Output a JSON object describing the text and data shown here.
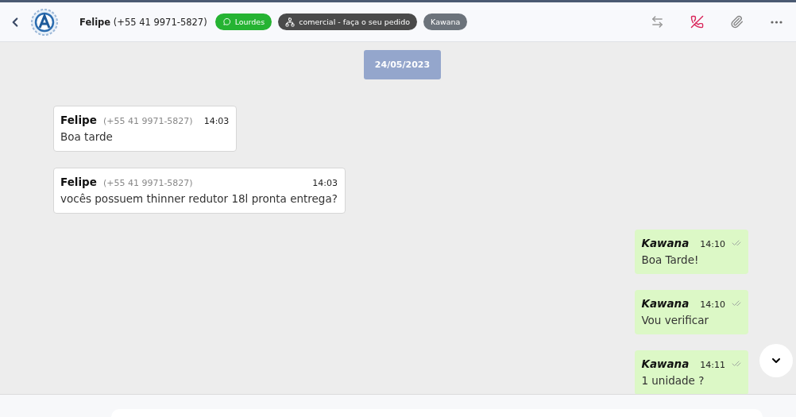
{
  "header": {
    "contact_name": "Felipe",
    "contact_phone": "(+55 41 9971-5827)",
    "tags": [
      {
        "kind": "whatsapp",
        "label": "Lourdes",
        "color": "#25b332"
      },
      {
        "kind": "queue",
        "label": "comercial - faça o seu pedido",
        "color": "#4a4a4a"
      },
      {
        "kind": "user",
        "label": "Kawana",
        "color": "#6c737b"
      }
    ]
  },
  "date_divider": "24/05/2023",
  "messages": [
    {
      "kind": "incoming",
      "author": "Felipe",
      "phone": "(+55 41 9971-5827)",
      "time": "14:03",
      "text": "Boa tarde"
    },
    {
      "kind": "incoming",
      "author": "Felipe",
      "phone": "(+55 41 9971-5827)",
      "time": "14:03",
      "text": "vocês possuem thinner redutor 18l pronta entrega?"
    },
    {
      "kind": "outgoing",
      "author": "Kawana",
      "time": "14:10",
      "text": "Boa Tarde!",
      "read": true
    },
    {
      "kind": "outgoing",
      "author": "Kawana",
      "time": "14:10",
      "text": "Vou verificar",
      "read": true
    },
    {
      "kind": "outgoing",
      "author": "Kawana",
      "time": "14:11",
      "text": "1 unidade ?",
      "read": true
    }
  ]
}
